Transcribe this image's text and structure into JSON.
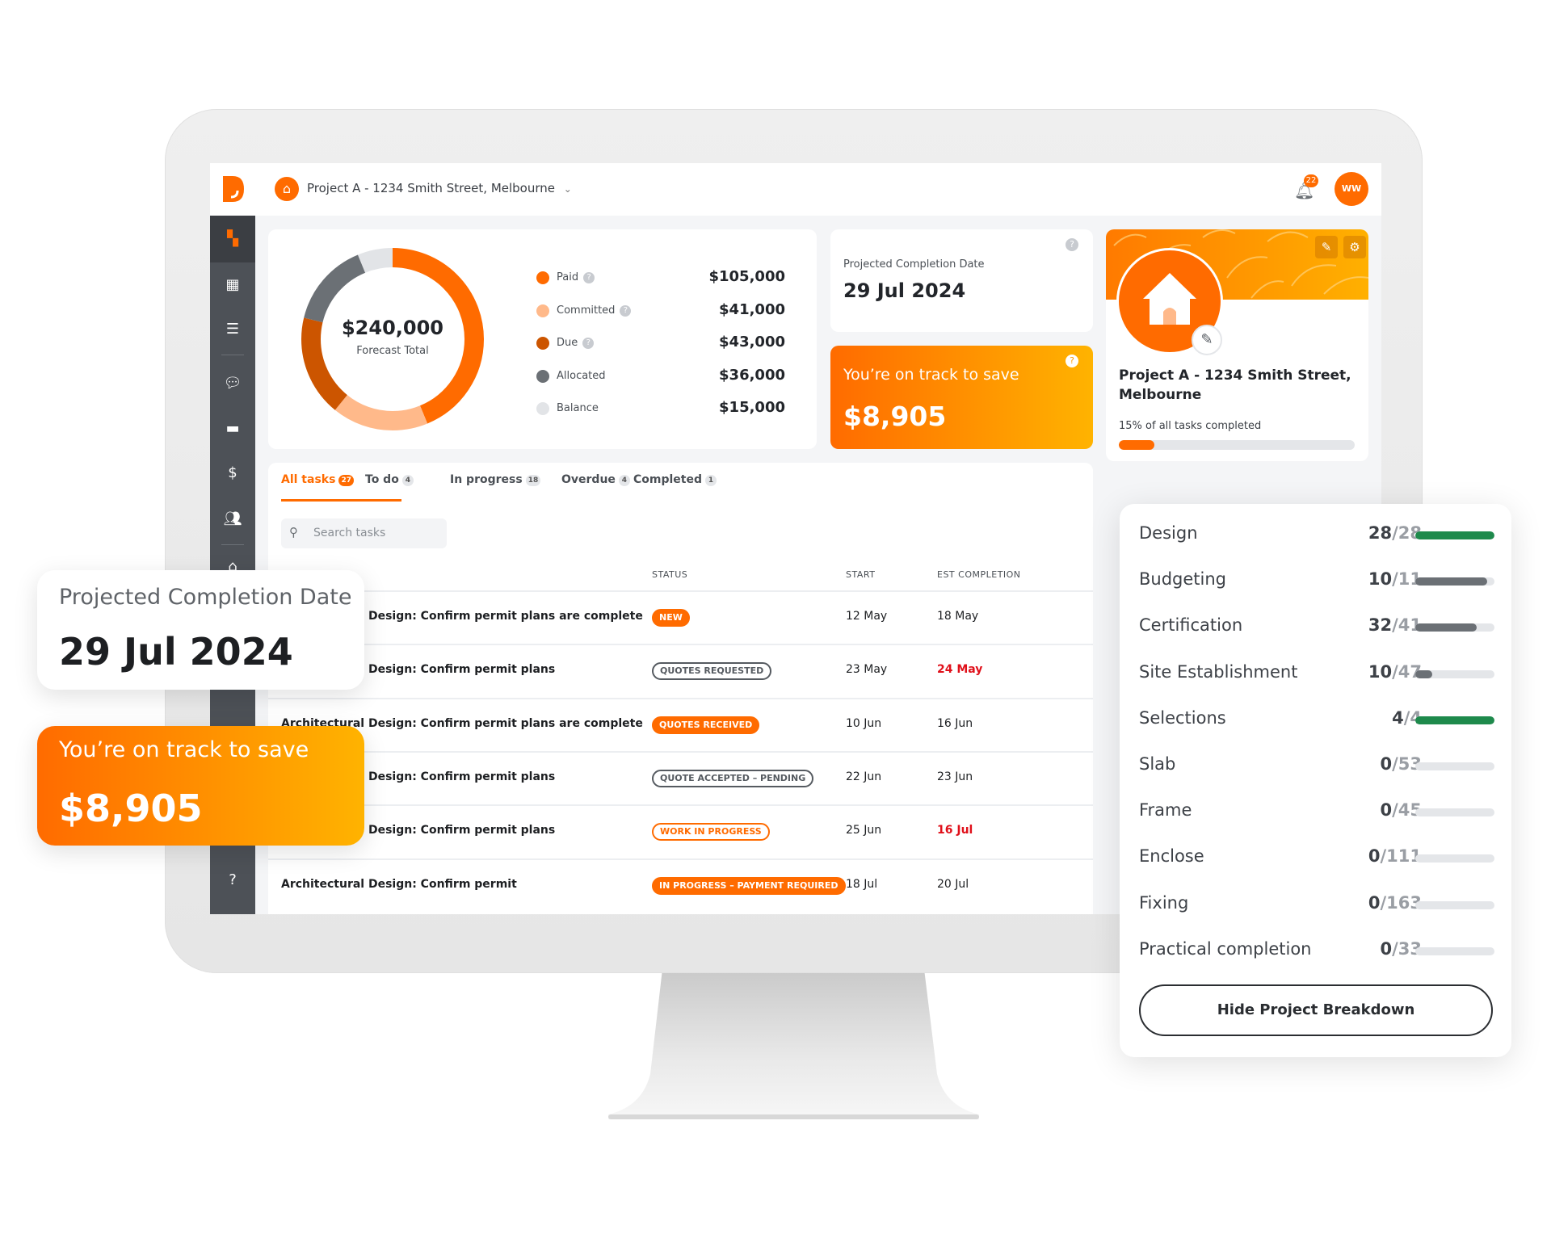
{
  "header": {
    "project_title": "Project A - 1234 Smith Street, Melbourne",
    "notification_count": "22",
    "avatar_initials": "WW"
  },
  "colors": {
    "brand": "#ff6b00",
    "complete": "#1e8a4c",
    "in_progress": "#6b7075",
    "late": "#e0101a"
  },
  "budget": {
    "total": "$240,000",
    "total_label": "Forecast Total",
    "items": [
      {
        "label": "Paid",
        "value": "$105,000",
        "amount": 105000,
        "color": "#ff6b00",
        "help": true
      },
      {
        "label": "Committed",
        "value": "$41,000",
        "amount": 41000,
        "color": "#ffb98a",
        "help": true
      },
      {
        "label": "Due",
        "value": "$43,000",
        "amount": 43000,
        "color": "#cc5500",
        "help": true
      },
      {
        "label": "Allocated",
        "value": "$36,000",
        "amount": 36000,
        "color": "#6b7075",
        "help": false
      },
      {
        "label": "Balance",
        "value": "$15,000",
        "amount": 15000,
        "color": "#e2e4e7",
        "help": false
      }
    ]
  },
  "completion": {
    "label": "Projected Completion Date",
    "date": "29 Jul 2024"
  },
  "savings": {
    "label": "You’re on track to save",
    "amount": "$8,905"
  },
  "project": {
    "title": "Project A - 1234 Smith Street, Melbourne",
    "progress_label": "15% of all tasks completed",
    "progress": 0.15
  },
  "tasks": {
    "tabs": [
      {
        "label": "All tasks",
        "count": "27"
      },
      {
        "label": "To do",
        "count": "4"
      },
      {
        "label": "In progress",
        "count": "18"
      },
      {
        "label": "Overdue",
        "count": "4"
      },
      {
        "label": "Completed",
        "count": "1"
      }
    ],
    "search_placeholder": "Search tasks",
    "columns": {
      "status": "STATUS",
      "start": "START",
      "end": "EST COMPLETION"
    },
    "rows": [
      {
        "name": "Architectural Design: Confirm permit plans are complete",
        "status": "NEW",
        "start": "12 May",
        "end": "18 May",
        "late": false
      },
      {
        "name": "Architectural Design: Confirm permit plans",
        "status": "QUOTES REQUESTED",
        "start": "23 May",
        "end": "24 May",
        "late": true
      },
      {
        "name": "Architectural Design: Confirm permit plans are complete",
        "status": "QUOTES RECEIVED",
        "start": "10 Jun",
        "end": "16 Jun",
        "late": false
      },
      {
        "name": "Architectural Design: Confirm permit plans",
        "status": "QUOTE ACCEPTED – PENDING",
        "start": "22 Jun",
        "end": "23 Jun",
        "late": false
      },
      {
        "name": "Architectural Design: Confirm permit plans",
        "status": "WORK IN PROGRESS",
        "start": "25 Jun",
        "end": "16 Jul",
        "late": true
      },
      {
        "name": "Architectural Design: Confirm permit",
        "status": "IN PROGRESS – PAYMENT REQUIRED",
        "start": "18 Jul",
        "end": "20 Jul",
        "late": false
      }
    ]
  },
  "breakdown": {
    "items": [
      {
        "label": "Design",
        "done": 28,
        "total": 28
      },
      {
        "label": "Budgeting",
        "done": 10,
        "total": 11
      },
      {
        "label": "Certification",
        "done": 32,
        "total": 41
      },
      {
        "label": "Site Establishment",
        "done": 10,
        "total": 47
      },
      {
        "label": "Selections",
        "done": 4,
        "total": 4
      },
      {
        "label": "Slab",
        "done": 0,
        "total": 53
      },
      {
        "label": "Frame",
        "done": 0,
        "total": 45
      },
      {
        "label": "Enclose",
        "done": 0,
        "total": 111
      },
      {
        "label": "Fixing",
        "done": 0,
        "total": 163
      },
      {
        "label": "Practical completion",
        "done": 0,
        "total": 33
      }
    ],
    "hide_button": "Hide Project Breakdown"
  }
}
